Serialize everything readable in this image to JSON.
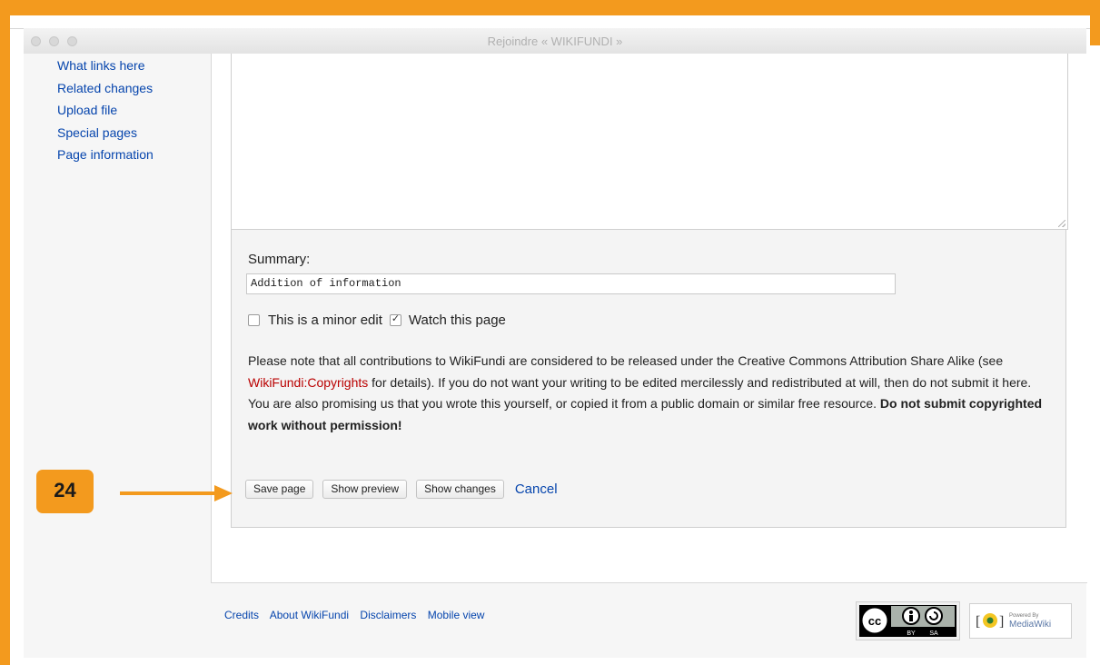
{
  "window": {
    "title": "Rejoindre « WIKIFUNDI »"
  },
  "sidebar": {
    "items": [
      {
        "label": "What links here"
      },
      {
        "label": "Related changes"
      },
      {
        "label": "Upload file"
      },
      {
        "label": "Special pages"
      },
      {
        "label": "Page information"
      }
    ]
  },
  "editor": {
    "summary_label": "Summary:",
    "summary_value": "Addition of information",
    "minor_edit_label": "This is a minor edit",
    "minor_edit_checked": false,
    "watch_label": "Watch this page",
    "watch_checked": true,
    "notice": {
      "part1": "Please note that all contributions to WikiFundi are considered to be released under the Creative Commons Attribution Share Alike (see ",
      "link": "WikiFundi:Copyrights",
      "part2": " for details). If you do not want your writing to be edited mercilessly and redistributed at will, then do not submit it here.",
      "part3": "You are also promising us that you wrote this yourself, or copied it from a public domain or similar free resource. ",
      "bold": "Do not submit copyrighted work without permission!"
    },
    "buttons": {
      "save": "Save page",
      "preview": "Show preview",
      "changes": "Show changes",
      "cancel": "Cancel"
    }
  },
  "annotation": {
    "step_number": "24",
    "color": "#f39a1e"
  },
  "footer": {
    "links": [
      "Credits",
      "About WikiFundi",
      "Disclaimers",
      "Mobile view"
    ],
    "cc_text": [
      "BY",
      "SA"
    ],
    "mw_text": [
      "Powered By",
      "MediaWiki"
    ]
  },
  "colors": {
    "link": "#0645ad",
    "copyright_link": "#ba0000",
    "frame": "#f39a1e"
  }
}
